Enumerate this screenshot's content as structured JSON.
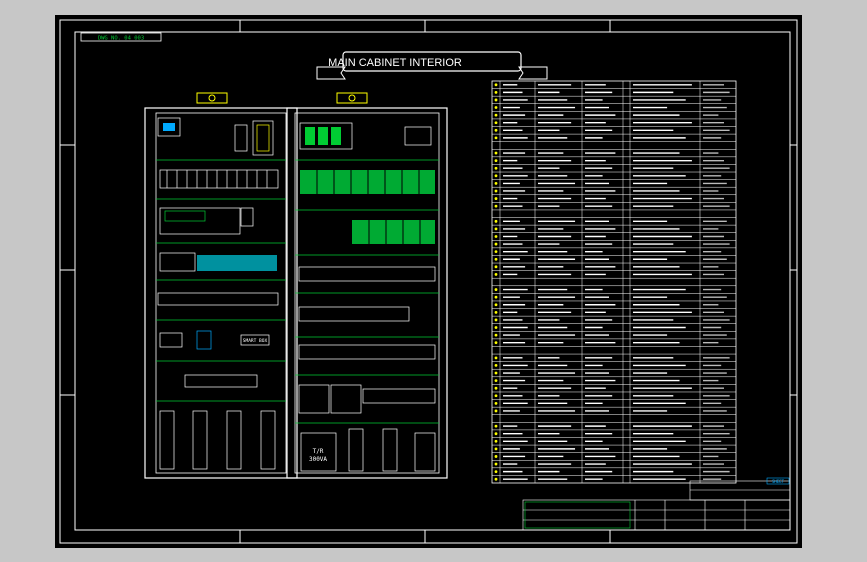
{
  "drawing": {
    "title": "MAIN CABINET INTERIOR",
    "header_tag": "DWG NO. 04 003",
    "transformer_label": [
      "T/R",
      "300VA"
    ],
    "corner_tag": "SHEET",
    "sub_label": "SMART BOX"
  },
  "parts_list": {
    "row_count": 53
  },
  "colors": {
    "background": "#000000",
    "line": "#ffffff",
    "component": "#00cc33",
    "terminal": "#ffff00",
    "callout": "#00aaff",
    "plc": "#00ccdd"
  }
}
